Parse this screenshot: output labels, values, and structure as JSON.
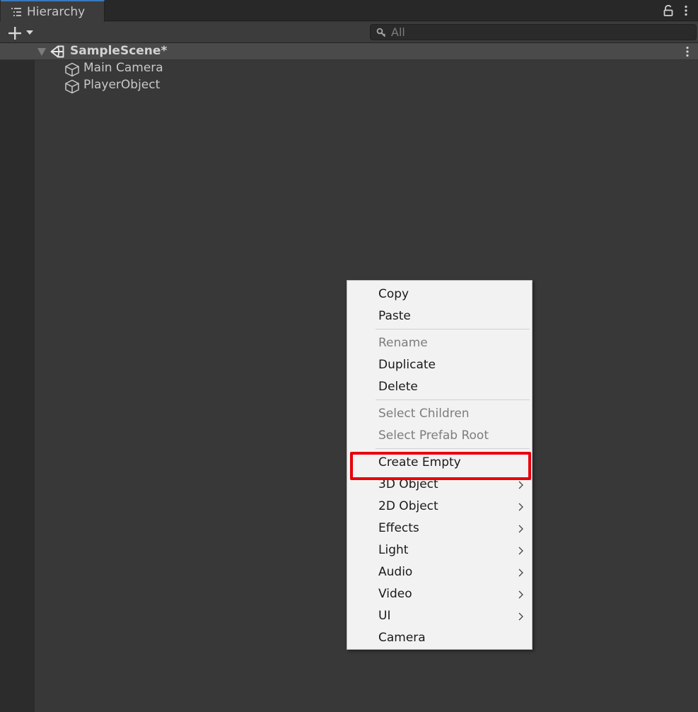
{
  "window": {
    "tab_title": "Hierarchy",
    "tab_icon": "hierarchy-list-icon",
    "header_icons": [
      "lock-icon",
      "kebab-menu-icon"
    ]
  },
  "toolbar": {
    "add_icon": "plus-icon",
    "dropdown_icon": "chevron-down-icon",
    "search_placeholder": "All",
    "search_icon": "search-icon"
  },
  "hierarchy": {
    "scene": {
      "name": "SampleScene*",
      "icon": "unity-scene-icon",
      "expanded": true
    },
    "objects": [
      {
        "name": "Main Camera",
        "icon": "cube-icon"
      },
      {
        "name": "PlayerObject",
        "icon": "cube-icon"
      }
    ]
  },
  "context_menu": {
    "items": [
      {
        "label": "Copy",
        "enabled": true
      },
      {
        "label": "Paste",
        "enabled": true
      },
      {
        "label": "Rename",
        "enabled": false
      },
      {
        "label": "Duplicate",
        "enabled": true
      },
      {
        "label": "Delete",
        "enabled": true
      },
      {
        "label": "Select Children",
        "enabled": false
      },
      {
        "label": "Select Prefab Root",
        "enabled": false
      },
      {
        "label": "Create Empty",
        "enabled": true,
        "highlighted": true
      },
      {
        "label": "3D Object",
        "enabled": true,
        "submenu": true
      },
      {
        "label": "2D Object",
        "enabled": true,
        "submenu": true
      },
      {
        "label": "Effects",
        "enabled": true,
        "submenu": true
      },
      {
        "label": "Light",
        "enabled": true,
        "submenu": true
      },
      {
        "label": "Audio",
        "enabled": true,
        "submenu": true
      },
      {
        "label": "Video",
        "enabled": true,
        "submenu": true
      },
      {
        "label": "UI",
        "enabled": true,
        "submenu": true
      },
      {
        "label": "Camera",
        "enabled": true
      }
    ]
  },
  "colors": {
    "panel_bg": "#383838",
    "menu_bg": "#f2f2f2",
    "highlight_outline": "#e8000b",
    "tab_accent": "#3a79bb"
  }
}
